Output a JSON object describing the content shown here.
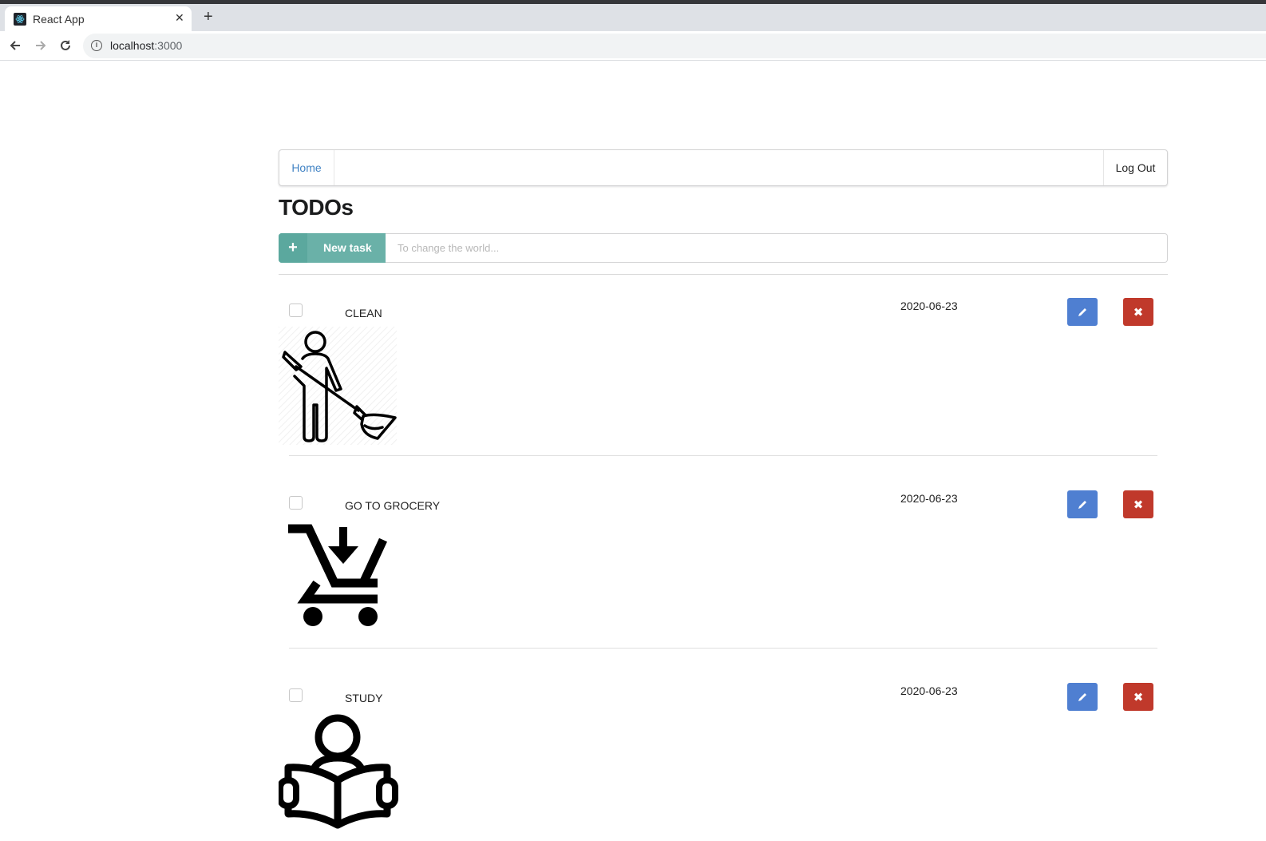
{
  "browser": {
    "tab_title": "React App",
    "tab_close": "✕",
    "new_tab": "+",
    "url_host": "localhost",
    "url_port": ":3000"
  },
  "menu": {
    "home_label": "Home",
    "logout_label": "Log Out"
  },
  "page": {
    "title": "TODOs"
  },
  "new_task": {
    "button_icon": "+",
    "button_label": "New task",
    "placeholder": "To change the world...",
    "value": ""
  },
  "todos": [
    {
      "title": "CLEAN",
      "date": "2020-06-23",
      "image_icon": "cleaning-person-icon",
      "checked": false
    },
    {
      "title": "GO TO GROCERY",
      "date": "2020-06-23",
      "image_icon": "shopping-cart-icon",
      "checked": false
    },
    {
      "title": "STUDY",
      "date": "2020-06-23",
      "image_icon": "reading-person-icon",
      "checked": false
    }
  ],
  "colors": {
    "accent_teal": "#6ab1a8",
    "edit_blue": "#4f7fd1",
    "delete_red": "#c0392b",
    "link_blue": "#4183c4"
  }
}
